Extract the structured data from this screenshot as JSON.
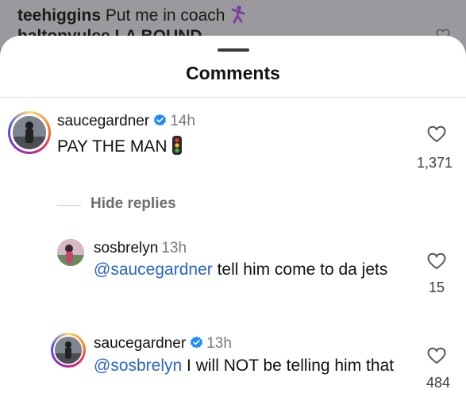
{
  "background_feed": {
    "line1_user": "teehiggins",
    "line1_text": "Put me in coach",
    "line2_text": "haltonvulee LA BOUND"
  },
  "sheet": {
    "title": "Comments"
  },
  "comments": [
    {
      "username": "saucegardner",
      "verified": true,
      "time": "14h",
      "text": "PAY THE MAN",
      "emoji": "traffic-light",
      "likes": "1,371"
    }
  ],
  "replies_toggle": "Hide replies",
  "replies": [
    {
      "username": "sosbrelyn",
      "verified": false,
      "time": "13h",
      "mention": "@saucegardner",
      "text": " tell him come to da jets",
      "likes": "15"
    },
    {
      "username": "saucegardner",
      "verified": true,
      "time": "13h",
      "mention": "@sosbrelyn",
      "text": " I will NOT be telling him that",
      "likes": "484"
    }
  ],
  "colors": {
    "mention": "#2a63c8",
    "verified": "#1d8cf8",
    "muted": "#7a7a7e"
  },
  "icons": [
    "heart-outline-icon",
    "verified-badge-icon",
    "traffic-light-emoji",
    "dancer-emoji"
  ]
}
